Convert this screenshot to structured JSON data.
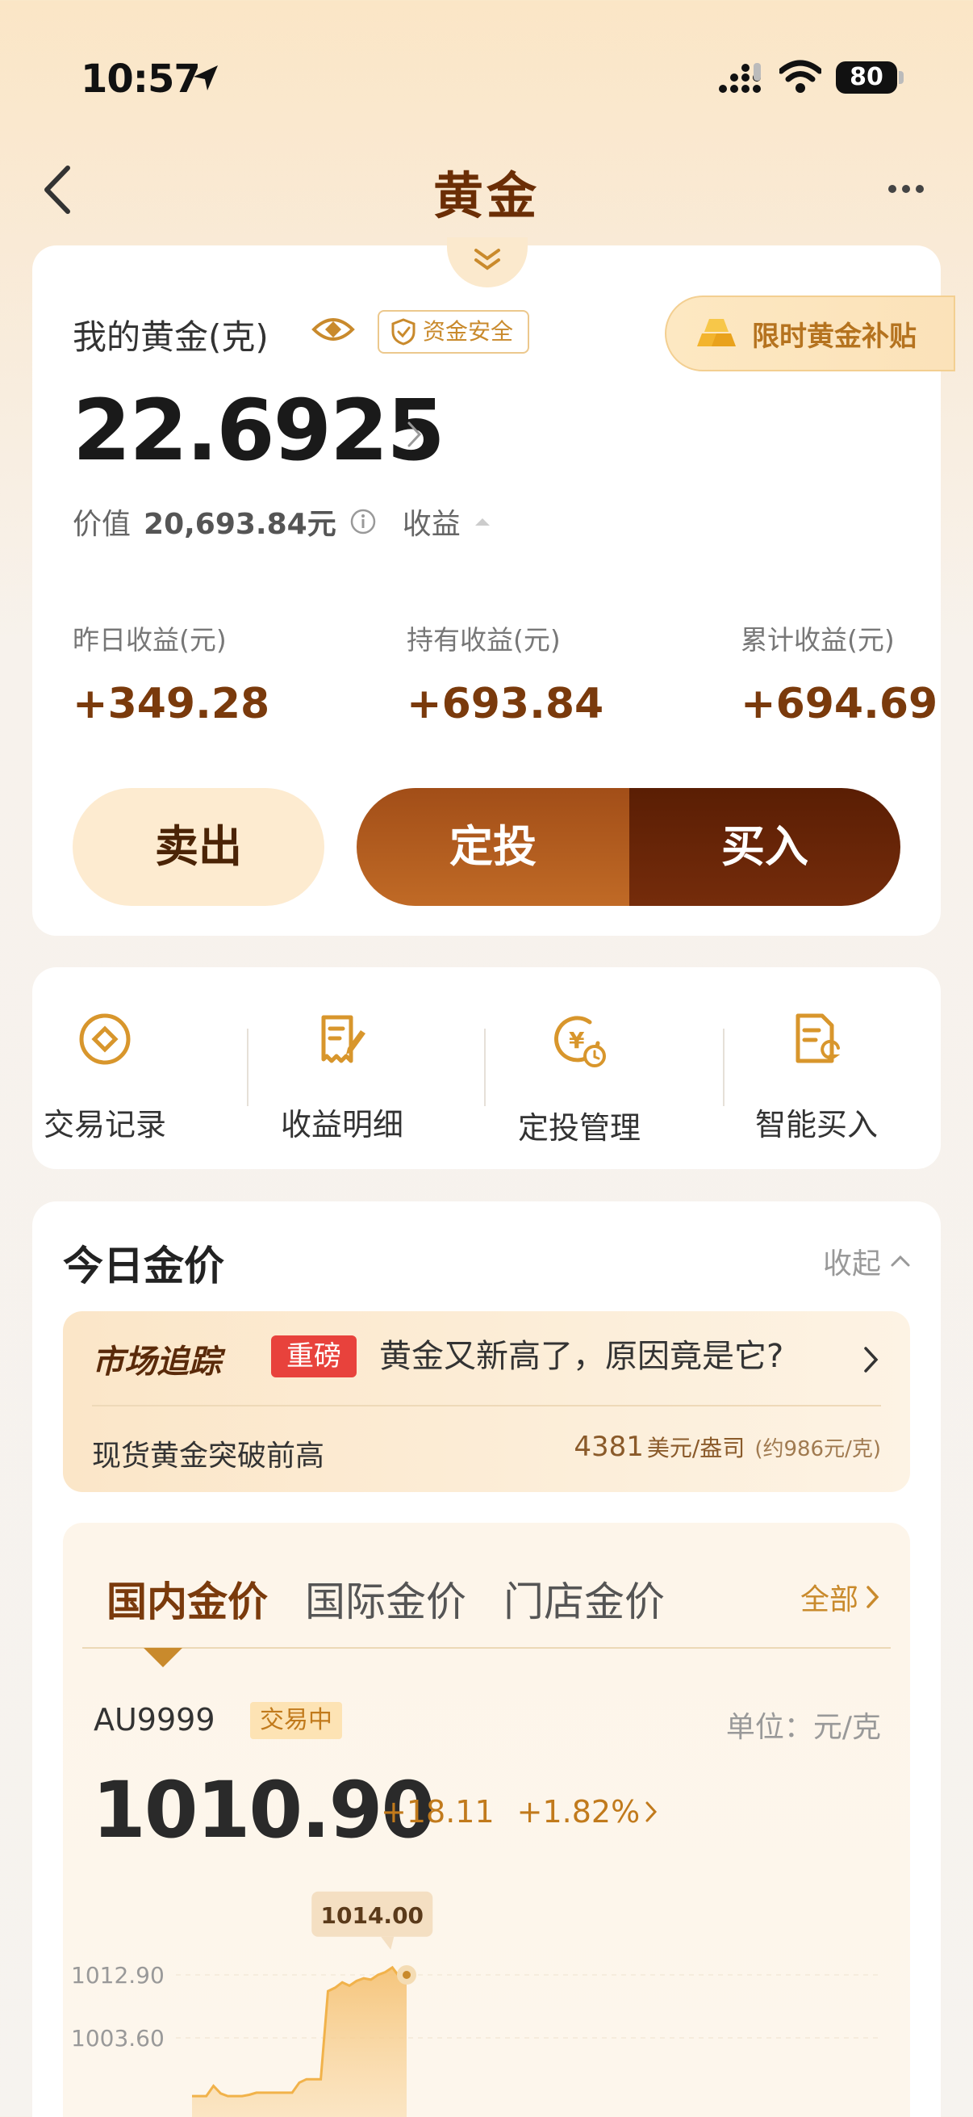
{
  "status": {
    "time": "10:57",
    "battery": "80"
  },
  "nav": {
    "title": "黄金"
  },
  "holdings": {
    "label": "我的黄金(克)",
    "safe_badge": "资金安全",
    "subsidy": "限时黄金补贴",
    "grams": "22.6925",
    "value_label": "价值",
    "value": "20,693.84元",
    "earnings_label": "收益",
    "stats": [
      {
        "label": "昨日收益(元)",
        "value": "+349.28"
      },
      {
        "label": "持有收益(元)",
        "value": "+693.84"
      },
      {
        "label": "累计收益(元)",
        "value": "+694.69"
      }
    ],
    "sell_label": "卖出",
    "plan_label": "定投",
    "buy_label": "买入"
  },
  "tools": [
    {
      "label": "交易记录",
      "icon": "record-icon"
    },
    {
      "label": "收益明细",
      "icon": "earnings-detail-icon"
    },
    {
      "label": "定投管理",
      "icon": "plan-manage-icon"
    },
    {
      "label": "智能买入",
      "icon": "smart-buy-icon"
    }
  ],
  "today": {
    "title": "今日金价",
    "collapse_label": "收起",
    "market": {
      "brand": "市场追踪",
      "tag": "重磅",
      "headline": "黄金又新高了，原因竟是它?",
      "sub": "现货黄金突破前高",
      "price": "4381",
      "price_unit": "美元/盎司",
      "price_approx": "(约986元/克)"
    },
    "tabs": [
      "国内金价",
      "国际金价",
      "门店金价"
    ],
    "all_label": "全部",
    "product": {
      "code": "AU9999",
      "status": "交易中",
      "unit": "单位：元/克",
      "price": "1010.90",
      "change": "+18.11",
      "change_pct": "+1.82%"
    }
  },
  "chart_data": {
    "type": "area",
    "y_ticks": [
      "1012.90",
      "1003.60"
    ],
    "tooltip": "1014.00",
    "series": [
      {
        "values": [
          995.0,
          995.0,
          995.0,
          996.5,
          995.4,
          995.0,
          995.0,
          995.0,
          995.2,
          995.5,
          995.5,
          995.5,
          995.5,
          995.5,
          995.5,
          997.0,
          997.5,
          997.5,
          997.5,
          1010.5,
          1011.0,
          1011.8,
          1011.3,
          1012.0,
          1012.4,
          1012.2,
          1012.9,
          1013.3,
          1014.0,
          1012.6,
          1012.9
        ]
      }
    ],
    "color": "#f1b24a"
  }
}
